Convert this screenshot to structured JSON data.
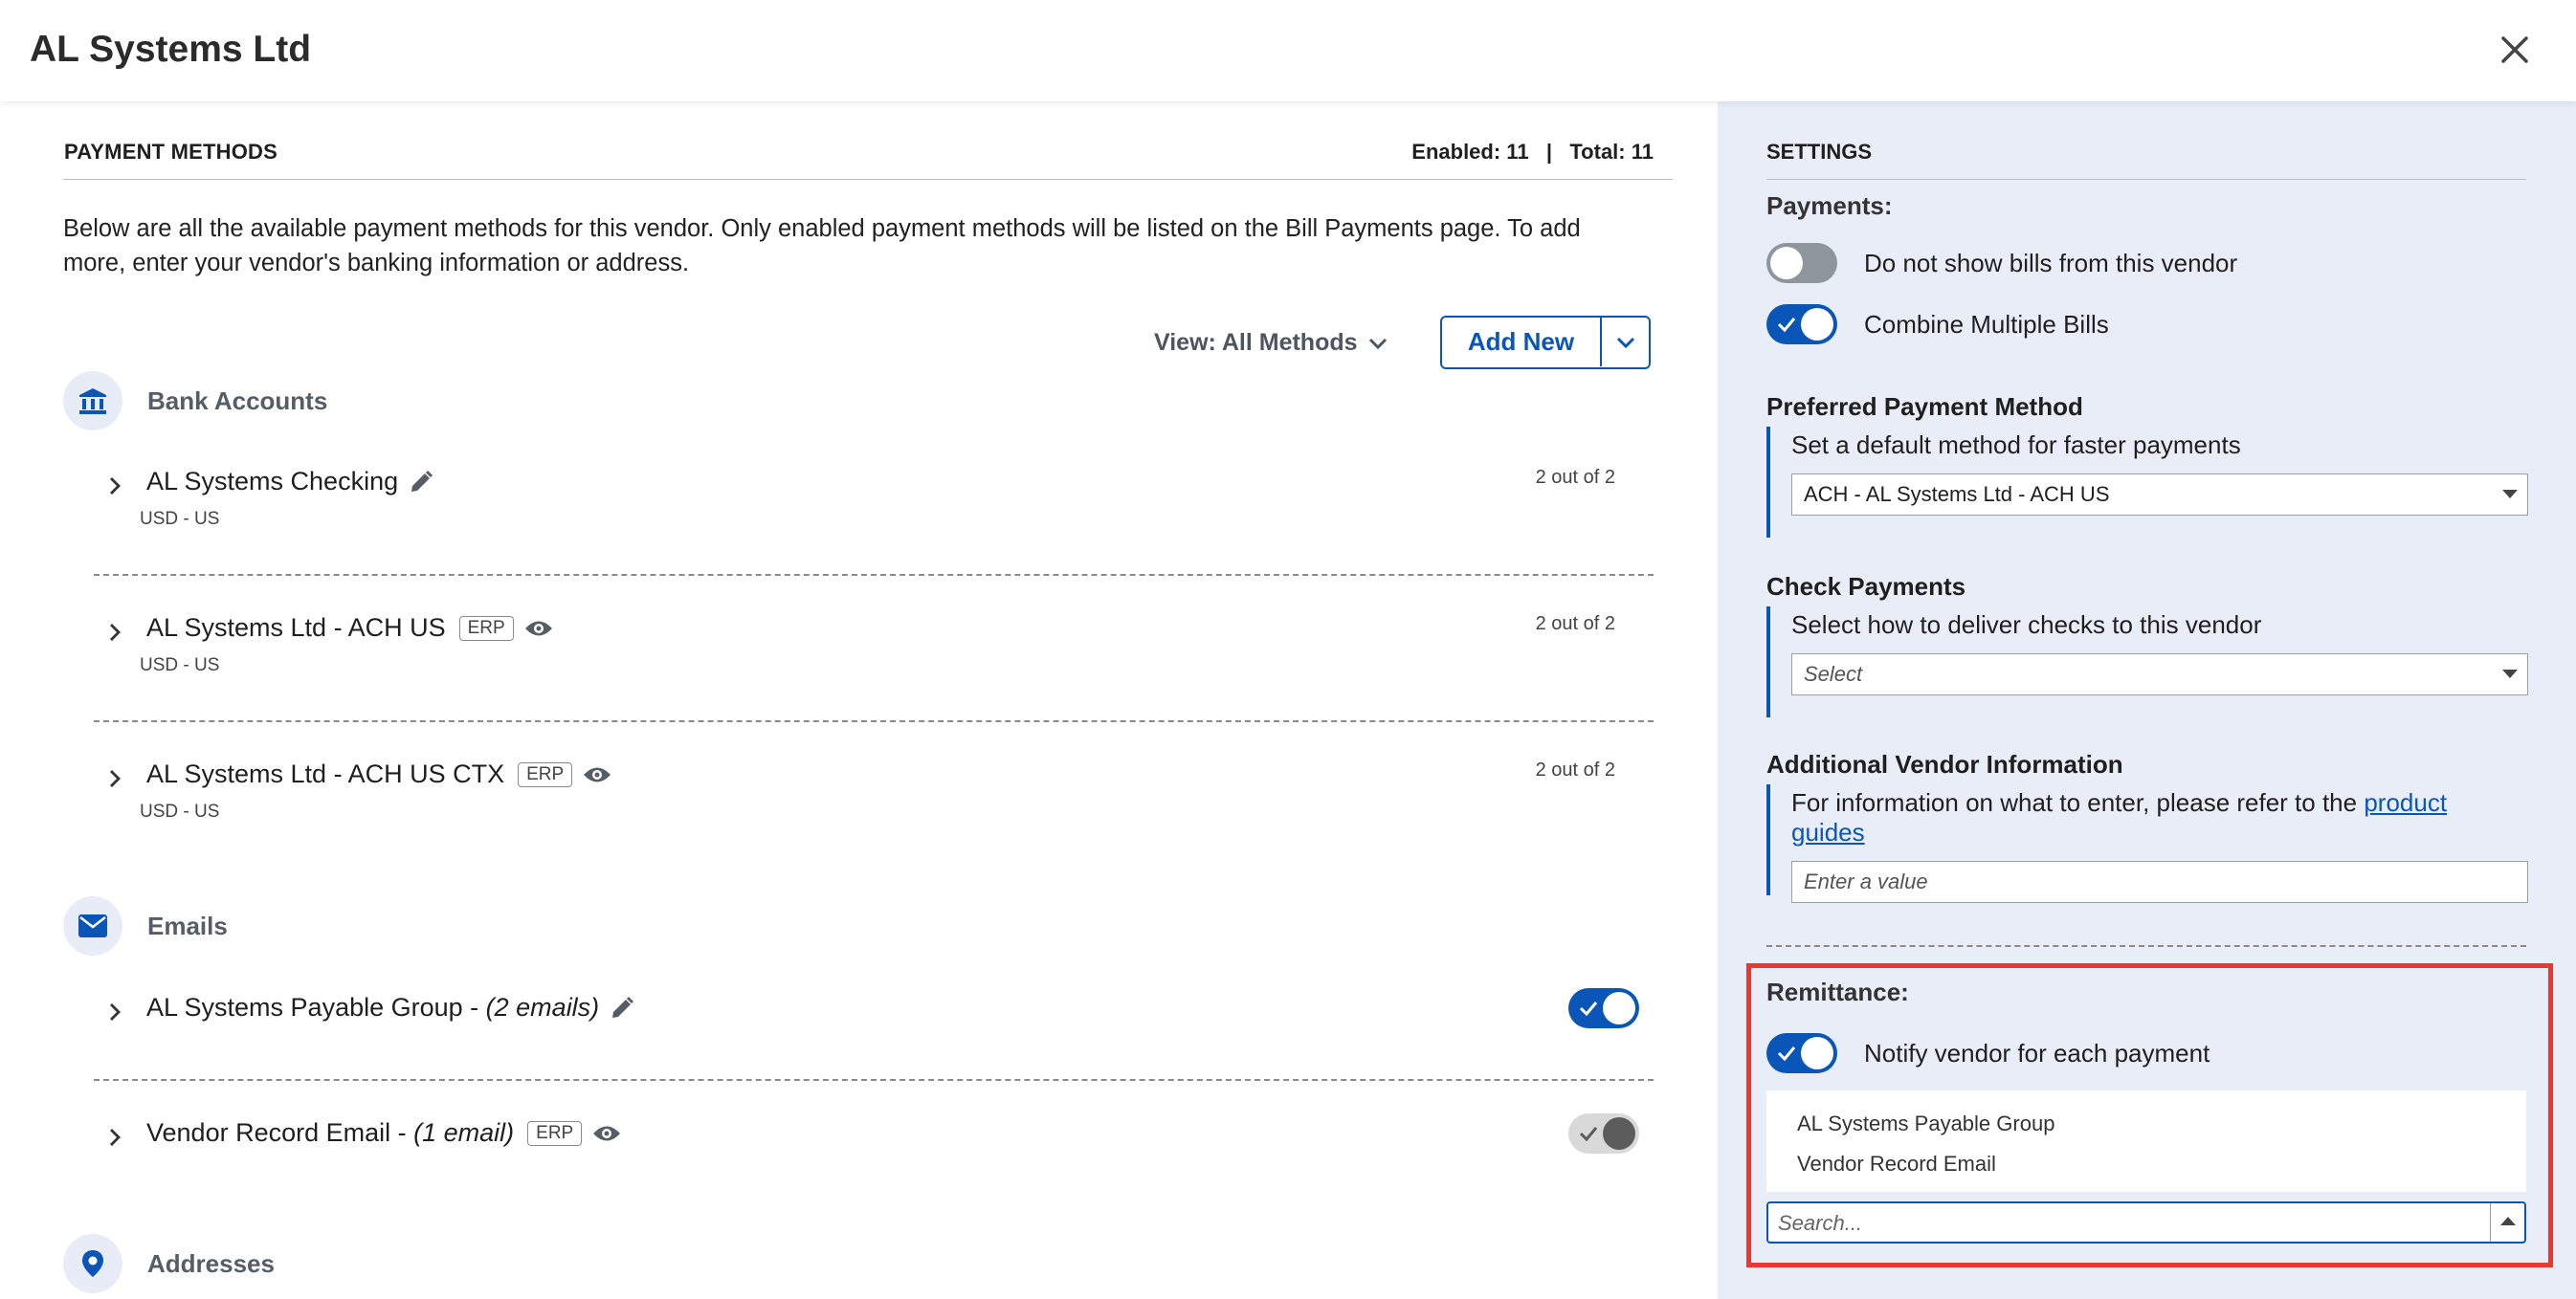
{
  "header": {
    "title": "AL Systems Ltd",
    "close_icon": "close-icon"
  },
  "payment_methods": {
    "heading": "PAYMENT METHODS",
    "counts": "Enabled: 11   |   Total: 11",
    "intro": "Below are all the available payment methods for this vendor. Only enabled payment methods will be listed on the Bill Payments page. To add more, enter your vendor's banking information or address.",
    "view_label": "View: All Methods",
    "add_new_label": "Add New",
    "bank_accounts": {
      "title": "Bank Accounts",
      "icon": "bank-icon",
      "items": [
        {
          "name": "AL Systems Checking",
          "sub": "USD - US",
          "count": "2 out of 2",
          "badge": "",
          "icon": "pencil-icon"
        },
        {
          "name": "AL Systems Ltd - ACH US",
          "sub": "USD - US",
          "count": "2 out of 2",
          "badge": "ERP",
          "icon": "eye-icon"
        },
        {
          "name": "AL Systems Ltd - ACH US CTX",
          "sub": "USD - US",
          "count": "2 out of 2",
          "badge": "ERP",
          "icon": "eye-icon"
        }
      ]
    },
    "emails": {
      "title": "Emails",
      "icon": "mail-icon",
      "items": [
        {
          "name": "AL Systems Payable Group - ",
          "detail": "(2 emails)",
          "badge": "",
          "icon": "pencil-icon",
          "enabled": true
        },
        {
          "name": "Vendor Record Email - ",
          "detail": "(1 email)",
          "badge": "ERP",
          "icon": "eye-icon",
          "enabled": true
        }
      ]
    },
    "addresses": {
      "title": "Addresses",
      "icon": "location-icon"
    }
  },
  "settings": {
    "heading": "SETTINGS",
    "payments_label": "Payments:",
    "do_not_show_label": "Do not show bills from this vendor",
    "do_not_show_on": false,
    "combine_label": "Combine Multiple Bills",
    "combine_on": true,
    "preferred": {
      "title": "Preferred Payment Method",
      "desc": "Set a default method for faster payments",
      "value": "ACH - AL Systems Ltd - ACH US"
    },
    "check": {
      "title": "Check Payments",
      "desc": "Select how to deliver checks to this vendor",
      "placeholder": "Select"
    },
    "additional": {
      "title": "Additional Vendor Information",
      "desc": "For information on what to enter, please refer to the ",
      "link": "product guides",
      "placeholder": "Enter a value"
    },
    "remittance": {
      "label": "Remittance:",
      "notify_label": "Notify vendor for each payment",
      "notify_on": true,
      "options": [
        "AL Systems Payable Group",
        "Vendor Record Email"
      ],
      "search_placeholder": "Search..."
    }
  },
  "colors": {
    "accent": "#0a56b8",
    "highlight": "#e53935",
    "panel": "#e8edf7"
  }
}
